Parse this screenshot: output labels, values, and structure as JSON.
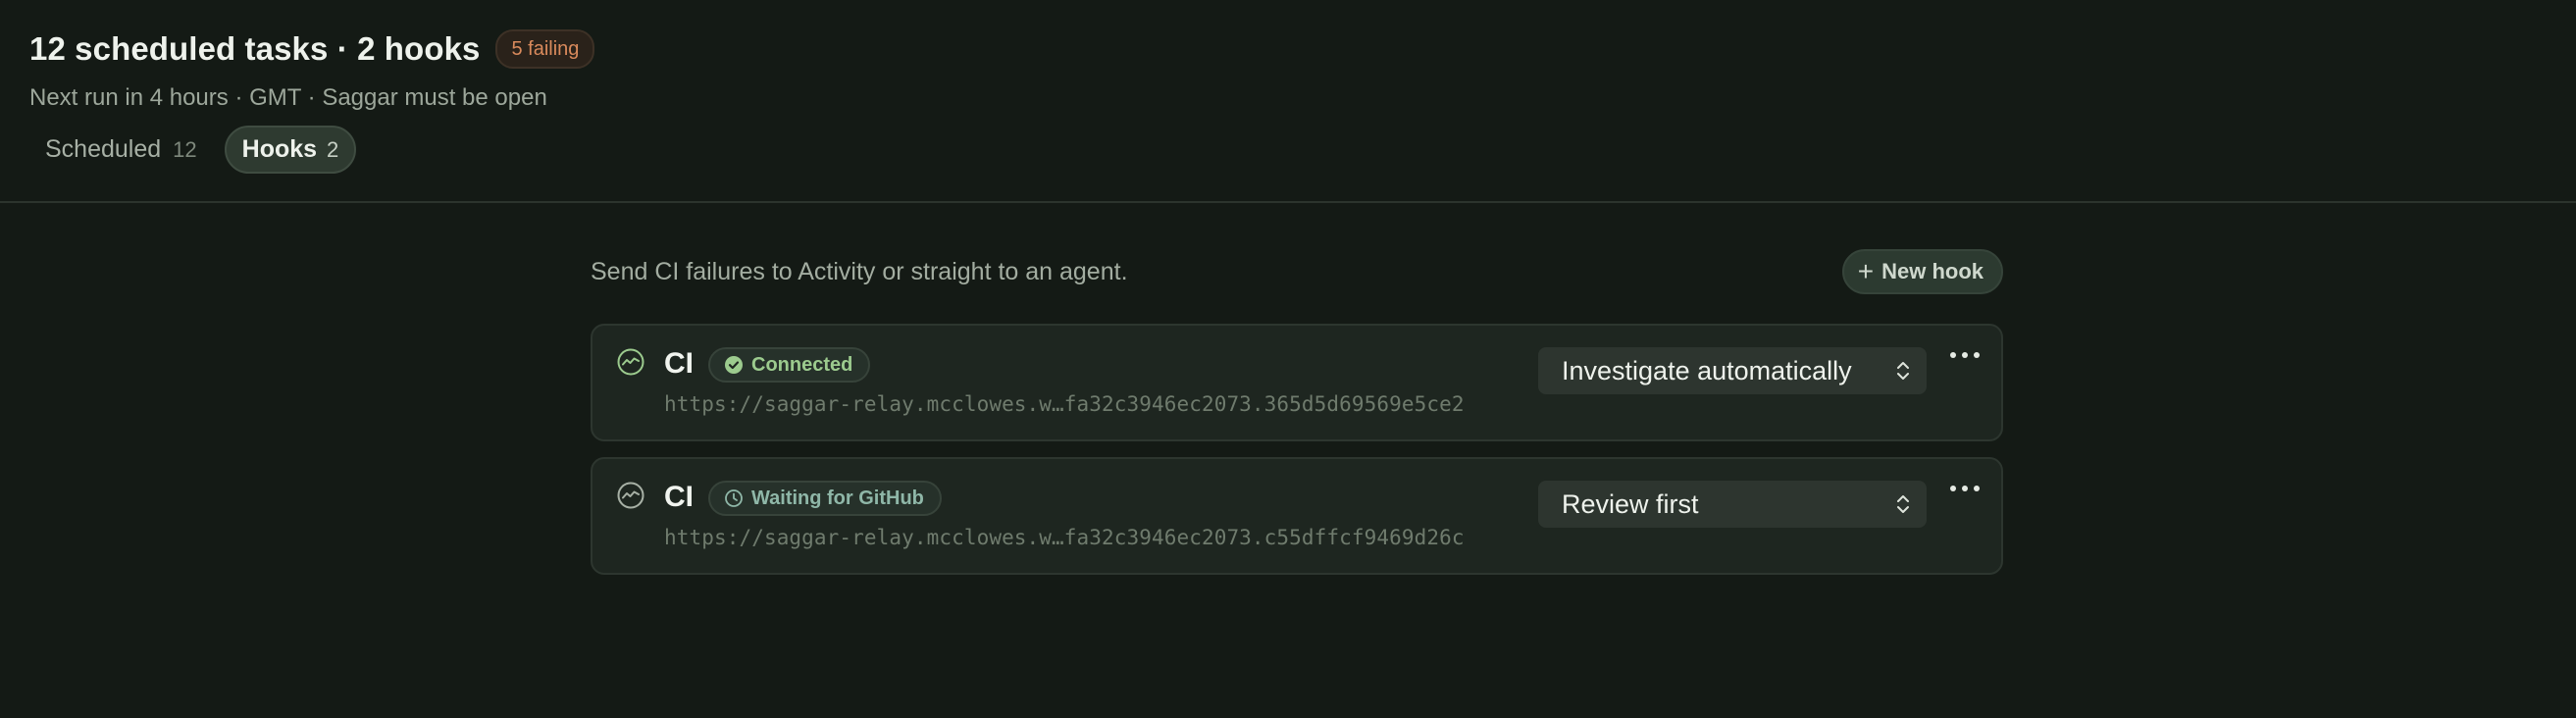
{
  "header": {
    "title": "12 scheduled tasks · 2 hooks",
    "failing_badge": "5 failing",
    "subtitle": "Next run in 4 hours · GMT · Saggar must be open"
  },
  "tabs": [
    {
      "label": "Scheduled",
      "count": "12",
      "active": false
    },
    {
      "label": "Hooks",
      "count": "2",
      "active": true
    }
  ],
  "hooks_panel": {
    "description": "Send CI failures to Activity or straight to an agent.",
    "new_hook_label": "New hook",
    "hooks": [
      {
        "name": "CI",
        "status": "Connected",
        "status_icon": "check-circle-icon",
        "url": "https://saggar-relay.mcclowes.w…fa32c3946ec2073.365d5d69569e5ce2",
        "mode": "Investigate automatically"
      },
      {
        "name": "CI",
        "status": "Waiting for GitHub",
        "status_icon": "clock-icon",
        "url": "https://saggar-relay.mcclowes.w…fa32c3946ec2073.c55dffcf9469d26c",
        "mode": "Review first"
      }
    ]
  },
  "colors": {
    "background": "#141a15",
    "card": "#1e2620",
    "accent_green": "#9ccb8e",
    "failing": "#d98a5c"
  }
}
